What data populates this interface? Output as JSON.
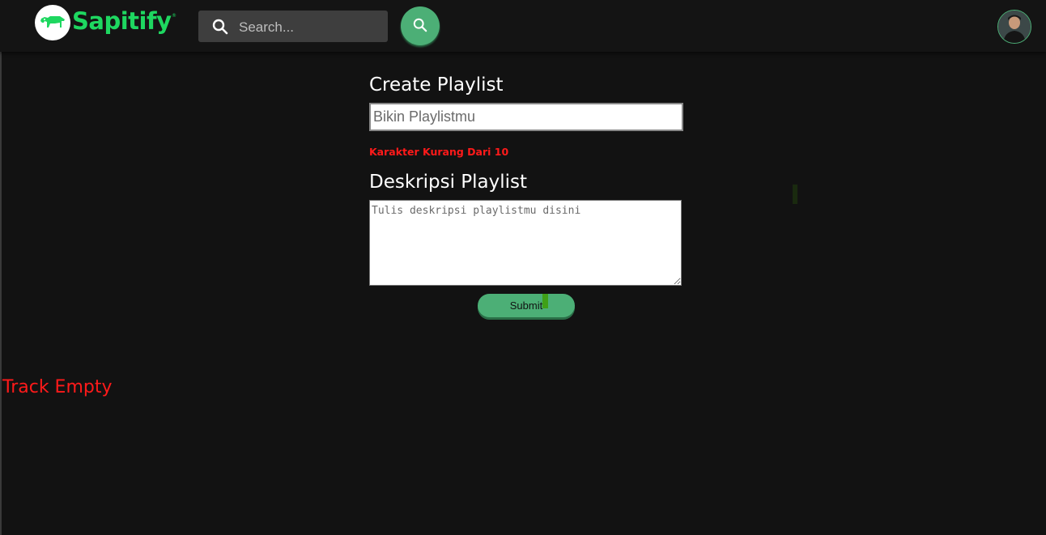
{
  "brand": {
    "name": "Sapitify",
    "trademark": "®",
    "accent_color": "#1ed760",
    "button_color": "#4caf76",
    "background_color": "#121212",
    "error_color": "#ff1a1a"
  },
  "header": {
    "search": {
      "placeholder": "Search...",
      "icon": "search-icon",
      "button_icon": "search-icon"
    },
    "avatar": "user-avatar"
  },
  "form": {
    "title_label": "Create Playlist",
    "title_placeholder": "Bikin Playlistmu",
    "title_error": "Karakter Kurang Dari 10",
    "description_label": "Deskripsi Playlist",
    "description_placeholder": "Tulis deskripsi playlistmu disini",
    "submit_label": "Submit"
  },
  "tracks": {
    "empty_message": "Track Empty"
  }
}
